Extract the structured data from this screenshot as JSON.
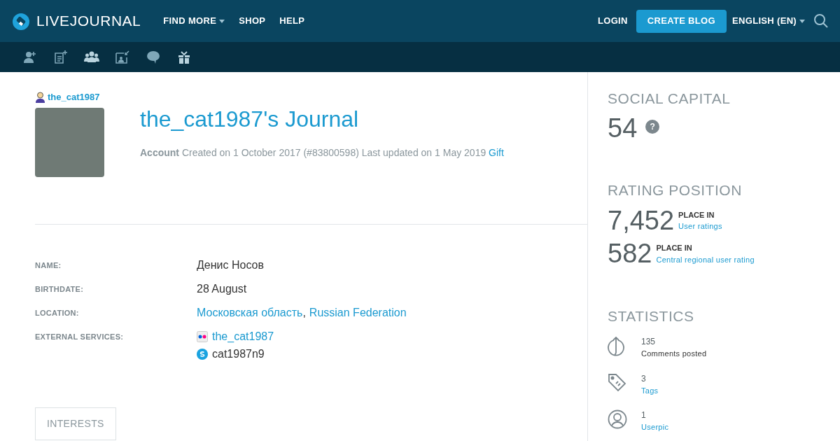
{
  "header": {
    "logo": "LIVEJOURNAL",
    "nav": [
      {
        "label": "FIND MORE",
        "dropdown": true
      },
      {
        "label": "SHOP",
        "dropdown": false
      },
      {
        "label": "HELP",
        "dropdown": false
      }
    ],
    "login": "LOGIN",
    "create": "CREATE BLOG",
    "language": "ENGLISH (EN)"
  },
  "toolbar": [
    {
      "kind": "add-friend"
    },
    {
      "kind": "new-post"
    },
    {
      "kind": "community"
    },
    {
      "kind": "inbox"
    },
    {
      "kind": "message"
    },
    {
      "kind": "gift"
    }
  ],
  "profile": {
    "username": "the_cat1987",
    "title": "the_cat1987's Journal",
    "account": "Account",
    "created": "Created on 1 October 2017 (#83800598) Last updated on 1 May 2019",
    "gift": "Gift"
  },
  "fields": [
    {
      "label": "NAME:",
      "parts": [
        {
          "text": "Денис Носов",
          "link": false
        }
      ]
    },
    {
      "label": "BIRTHDATE:",
      "parts": [
        {
          "text": "28 August",
          "link": false
        }
      ]
    },
    {
      "label": "LOCATION:",
      "parts": [
        {
          "text": "Московская область",
          "link": true
        },
        {
          "text": ",",
          "link": false
        },
        {
          "text": "Russian Federation",
          "link": true
        }
      ]
    },
    {
      "label": "EXTERNAL SERVICES:",
      "services": [
        {
          "kind": "flickr",
          "text": "the_cat1987",
          "link": true
        },
        {
          "kind": "skype",
          "text": "cat1987n9",
          "link": false
        }
      ]
    }
  ],
  "interests_tab": "INTERESTS",
  "sidebar": {
    "social_title": "SOCIAL CAPITAL",
    "social_value": "54",
    "help": "?",
    "rating_title": "RATING POSITION",
    "ratings": [
      {
        "value": "7,452",
        "place": "PLACE IN",
        "link": "User ratings"
      },
      {
        "value": "582",
        "place": "PLACE IN",
        "link": "Central regional user rating"
      }
    ],
    "stats_title": "STATISTICS",
    "stats": [
      {
        "kind": "comments",
        "count": "135",
        "label": "Comments posted",
        "link": false
      },
      {
        "kind": "tags",
        "count": "3",
        "label": "Tags",
        "link": true
      },
      {
        "kind": "userpic",
        "count": "1",
        "label": "Userpic",
        "link": true
      }
    ]
  }
}
